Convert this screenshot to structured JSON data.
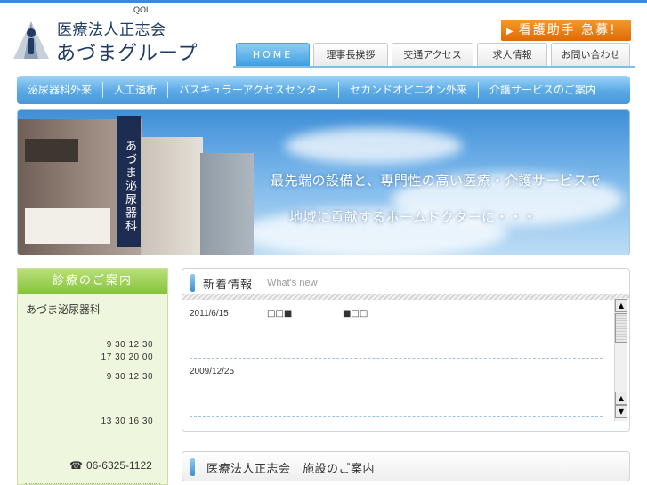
{
  "header": {
    "qol_label": "QOL",
    "org_name": "医療法人正志会",
    "group_name": "あづまグループ",
    "recruit_banner": "看護助手 急募!"
  },
  "top_nav": {
    "tabs": [
      {
        "label": "HOME",
        "active": true
      },
      {
        "label": "理事長挨拶",
        "active": false
      },
      {
        "label": "交通アクセス",
        "active": false
      },
      {
        "label": "求人情報",
        "active": false
      },
      {
        "label": "お問い合わせ",
        "active": false
      }
    ]
  },
  "sub_nav": {
    "items": [
      {
        "label": "泌尿器科外来"
      },
      {
        "label": "人工透析"
      },
      {
        "label": "バスキュラーアクセスセンター"
      },
      {
        "label": "セカンドオピニオン外来"
      },
      {
        "label": "介護サービスのご案内"
      }
    ]
  },
  "hero": {
    "sign_text": "あづま泌尿器科",
    "line1": "最先端の設備と、専門性の高い医療・介護サービスで",
    "line2": "地域に貢献するホームドクターに・・・"
  },
  "clinic_panel": {
    "heading": "診療のご案内",
    "clinic_name": "あづま泌尿器科",
    "hours": [
      "9 30 12 30",
      "17 30 20 00",
      "9 30 12 30",
      "13 30 16 30"
    ],
    "phone": "06-6325-1122"
  },
  "news": {
    "title": "新着情報",
    "subtitle": "What's new",
    "entries": [
      {
        "date": "2011/6/15",
        "text": "□□■",
        "text2": "■□□"
      },
      {
        "date": "2009/12/25",
        "text": ""
      }
    ]
  },
  "facility": {
    "title": "医療法人正志会　施設のご案内"
  },
  "colors": {
    "accent_blue": "#4a98d8",
    "recruit_orange": "#e06a06",
    "clinic_green": "#86c33c",
    "header_navy": "#1f3b66"
  }
}
